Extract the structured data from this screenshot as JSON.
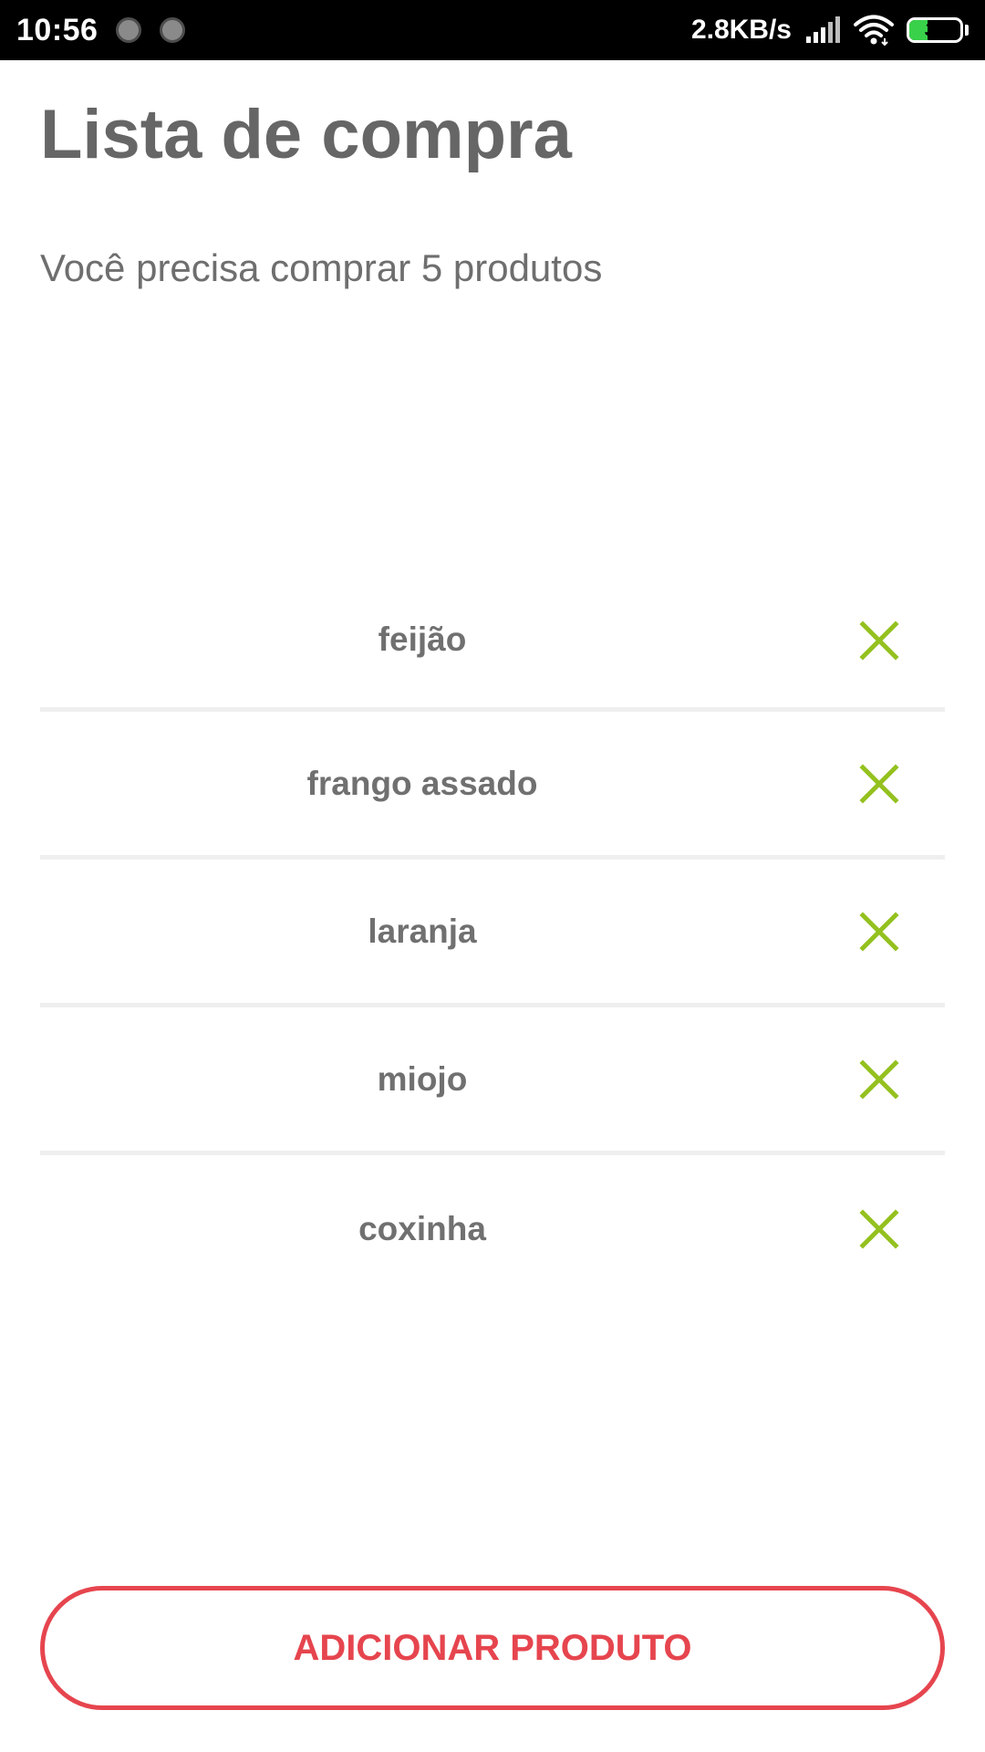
{
  "status_bar": {
    "time": "10:56",
    "network_speed": "2.8KB/s",
    "battery_level": "36",
    "battery_fraction": 0.36,
    "battery_color": "#3ad14a",
    "icons": [
      "notification-dot-icon",
      "notification-dot-icon",
      "signal-icon",
      "wifi-icon",
      "battery-icon"
    ]
  },
  "header": {
    "title": "Lista de compra",
    "subtitle": "Você precisa comprar 5 produtos"
  },
  "products": [
    {
      "name": "feijão",
      "remove_icon": "close-icon"
    },
    {
      "name": "frango assado",
      "remove_icon": "close-icon"
    },
    {
      "name": "laranja",
      "remove_icon": "close-icon"
    },
    {
      "name": "miojo",
      "remove_icon": "close-icon"
    },
    {
      "name": "coxinha",
      "remove_icon": "close-icon"
    }
  ],
  "actions": {
    "add_label": "ADICIONAR PRODUTO"
  },
  "colors": {
    "title_text": "#666666",
    "remove_icon": "#94c11f",
    "accent": "#e6454e",
    "divider": "#efefef"
  }
}
